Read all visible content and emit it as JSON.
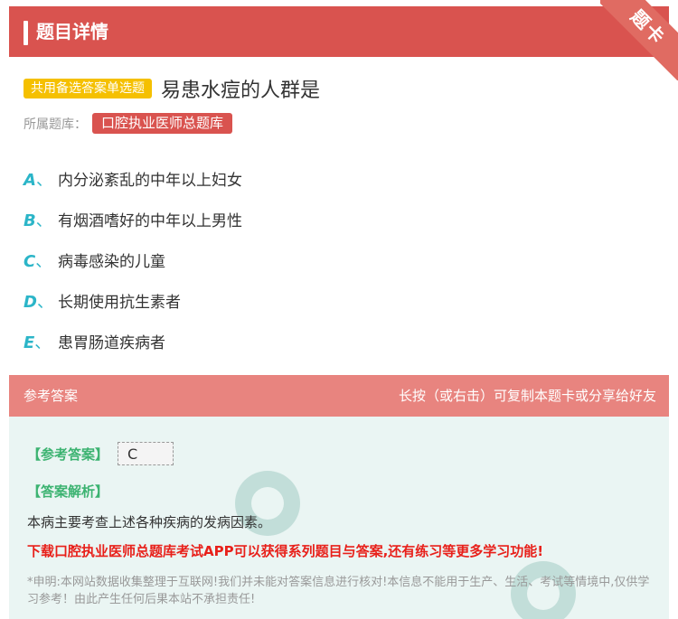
{
  "header": {
    "title": "题目详情",
    "ribbon": "题卡"
  },
  "question": {
    "type_tag": "共用备选答案单选题",
    "text": "易患水痘的人群是",
    "bank_label": "所属题库：",
    "bank_name": "口腔执业医师总题库"
  },
  "options": [
    {
      "letter": "A",
      "sep": "、",
      "text": "内分泌紊乱的中年以上妇女"
    },
    {
      "letter": "B",
      "sep": "、",
      "text": "有烟酒嗜好的中年以上男性"
    },
    {
      "letter": "C",
      "sep": "、",
      "text": "病毒感染的儿童"
    },
    {
      "letter": "D",
      "sep": "、",
      "text": "长期使用抗生素者"
    },
    {
      "letter": "E",
      "sep": "、",
      "text": "患胃肠道疾病者"
    }
  ],
  "answer_section": {
    "left_label": "参考答案",
    "right_hint": "长按（或右击）可复制本题卡或分享给好友",
    "answer_label": "【参考答案】",
    "answer_value": "C",
    "analysis_label": "【答案解析】",
    "analysis_text": "本病主要考查上述各种疾病的发病因素。",
    "promo": "下载口腔执业医师总题库考试APP可以获得系列题目与答案,还有练习等更多学习功能!",
    "disclaimer": "*申明:本网站数据收集整理于互联网!我们并未能对答案信息进行核对!本信息不能用于生产、生活、考试等情境中,仅供学习参考！由此产生任何后果本站不承担责任!"
  },
  "colors": {
    "header_red": "#d9534f",
    "tag_yellow": "#f5c000",
    "option_letter": "#2bb5c8",
    "answer_green": "#3cb371",
    "promo_red": "#e8201a"
  }
}
